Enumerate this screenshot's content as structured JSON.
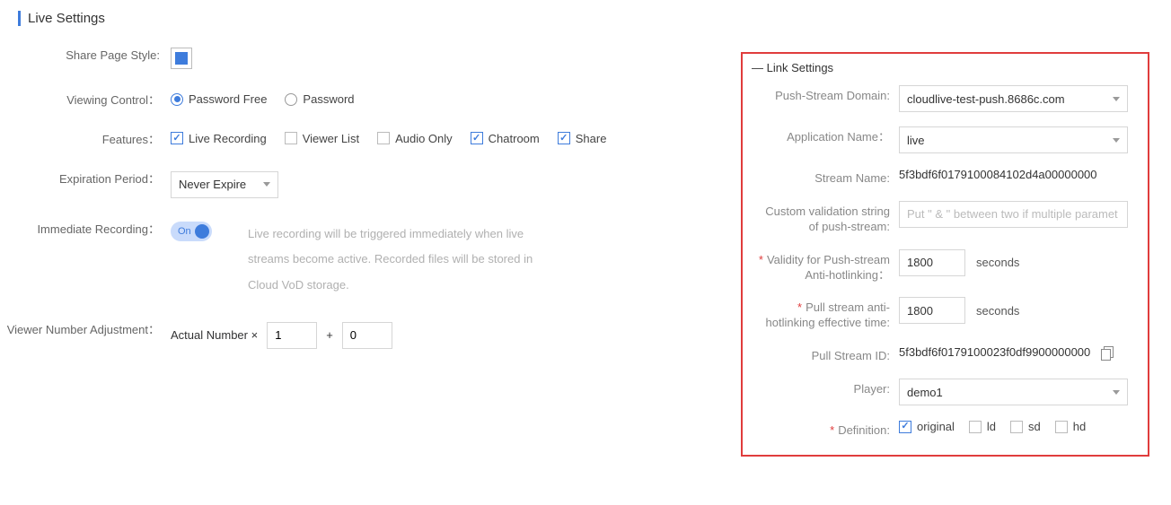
{
  "title": "Live Settings",
  "left": {
    "sharePageStyle": {
      "label": "Share Page Style:",
      "color": "#3e7cdc"
    },
    "viewingControl": {
      "label": "Viewing Control：",
      "options": {
        "free": "Password Free",
        "pass": "Password"
      },
      "selected": "free"
    },
    "features": {
      "label": "Features：",
      "items": {
        "liveRecording": {
          "label": "Live Recording",
          "checked": true
        },
        "viewerList": {
          "label": "Viewer List",
          "checked": false
        },
        "audioOnly": {
          "label": "Audio Only",
          "checked": false
        },
        "chatroom": {
          "label": "Chatroom",
          "checked": true
        },
        "share": {
          "label": "Share",
          "checked": true
        }
      }
    },
    "expiration": {
      "label": "Expiration Period：",
      "value": "Never Expire"
    },
    "immediateRecording": {
      "label": "Immediate Recording：",
      "state": "On",
      "hint": "Live recording will be triggered immediately when live streams become active. Recorded files will be stored in Cloud VoD storage."
    },
    "viewerAdjust": {
      "label": "Viewer Number Adjustment：",
      "prefix": "Actual Number ×",
      "mult": "1",
      "plus": "+",
      "add": "0"
    }
  },
  "right": {
    "legend": "Link Settings",
    "pushDomain": {
      "label": "Push-Stream Domain:",
      "value": "cloudlive-test-push.8686c.com"
    },
    "appName": {
      "label": "Application Name：",
      "value": "live"
    },
    "streamName": {
      "label": "Stream Name:",
      "value": "5f3bdf6f0179100084102d4a00000000"
    },
    "customValidation": {
      "label": "Custom validation string of push-stream:",
      "placeholder": "Put \" & \" between two if multiple paramet"
    },
    "pushValidity": {
      "label": "Validity for Push-stream Anti-hotlinking：",
      "value": "1800",
      "unit": "seconds"
    },
    "pullValidity": {
      "label": "Pull stream anti-hotlinking effective time:",
      "value": "1800",
      "unit": "seconds"
    },
    "pullId": {
      "label": "Pull Stream ID:",
      "value": "5f3bdf6f0179100023f0df9900000000"
    },
    "player": {
      "label": "Player:",
      "value": "demo1"
    },
    "definition": {
      "label": "Definition:",
      "items": {
        "original": {
          "label": "original",
          "checked": true
        },
        "ld": {
          "label": "ld",
          "checked": false
        },
        "sd": {
          "label": "sd",
          "checked": false
        },
        "hd": {
          "label": "hd",
          "checked": false
        }
      }
    }
  }
}
